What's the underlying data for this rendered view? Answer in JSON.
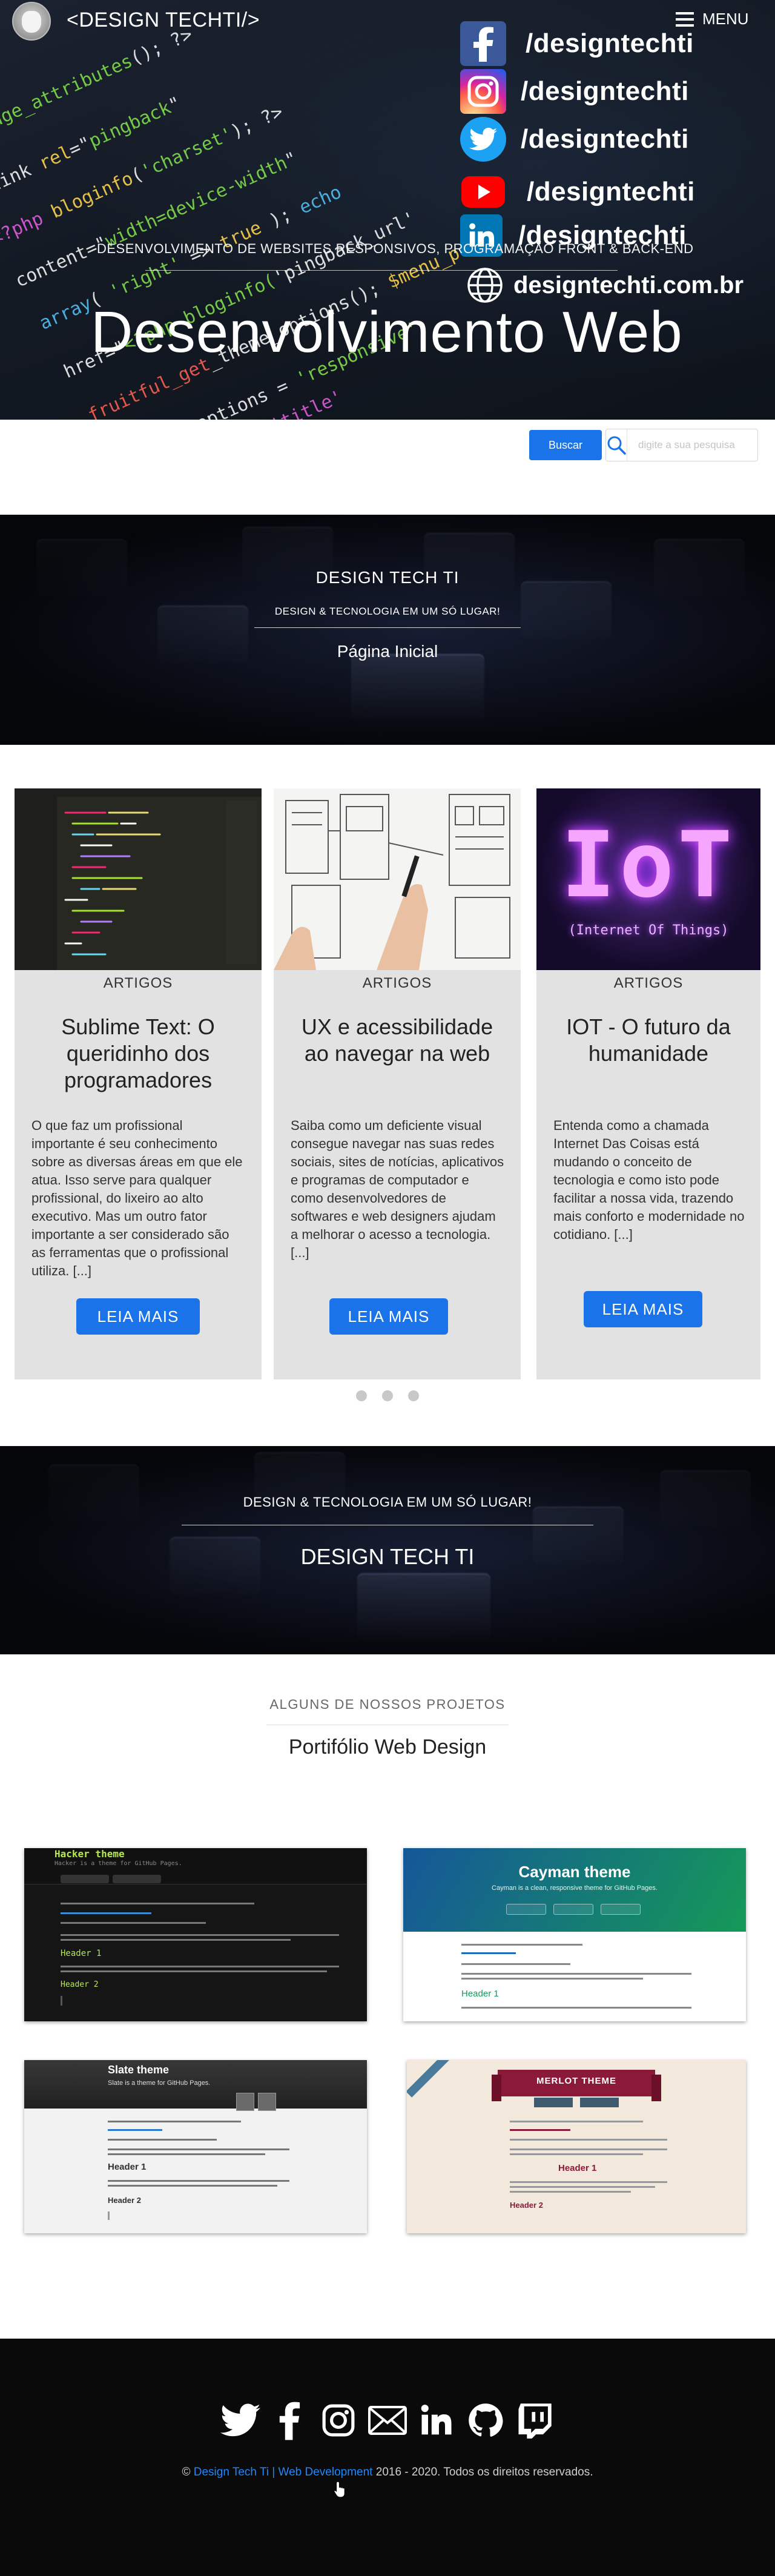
{
  "header": {
    "site_title": "<DESIGN TECHTI/>",
    "menu_label": "MENU"
  },
  "social_overlay": [
    {
      "network": "facebook",
      "icon": "facebook-icon",
      "color": "#3b5998",
      "handle": "/designtechti"
    },
    {
      "network": "instagram",
      "icon": "instagram-icon",
      "color": "#d6249f",
      "handle": "/designtechti"
    },
    {
      "network": "twitter",
      "icon": "twitter-icon",
      "color": "#1da1f2",
      "handle": "/designtechti"
    },
    {
      "network": "youtube",
      "icon": "youtube-icon",
      "color": "#ff0000",
      "handle": "/designtechti"
    },
    {
      "network": "linkedin",
      "icon": "linkedin-icon",
      "color": "#0077b5",
      "handle": "/designtechti"
    }
  ],
  "website": {
    "icon": "globe-icon",
    "label": "designtechti.com.br"
  },
  "hero": {
    "tagline": "DESENVOLVIMENTO DE WEBSITES RESPONSIVOS, PROGRAMAÇÃO FRONT & BACK-END",
    "heading": "Desenvolvimento Web"
  },
  "search": {
    "button_label": "Buscar",
    "placeholder": "digite a sua pesquisa"
  },
  "banner_top": {
    "title": "DESIGN TECH TI",
    "subtitle": "DESIGN & TECNOLOGIA EM UM SÓ LUGAR!",
    "link": "Página Inicial"
  },
  "articles": [
    {
      "category": "ARTIGOS",
      "title": "Sublime Text: O queridinho dos programadores",
      "excerpt": "O que faz um profissional importante é seu conhecimento sobre as diversas áreas em que ele atua. Isso serve para qualquer profissional, do lixeiro ao alto executivo. Mas um outro fator importante a ser considerado são as ferramentas que o profissional utiliza. [...]",
      "button": "LEIA MAIS"
    },
    {
      "category": "ARTIGOS",
      "title": "UX e acessibilidade ao navegar na web",
      "excerpt": "Saiba como um deficiente visual consegue navegar nas suas redes sociais, sites de notícias, aplicativos e programas de computador e como desenvolvedores de softwares e web designers ajudam a melhorar o acesso a tecnologia. [...]",
      "button": "LEIA MAIS"
    },
    {
      "category": "ARTIGOS",
      "title": "IOT - O futuro da humanidade",
      "excerpt": "Entenda como a chamada Internet Das Coisas está mudando o conceito de tecnologia e como isto pode facilitar a nossa vida, trazendo mais conforto e modernidade no cotidiano. [...]",
      "button": "LEIA MAIS",
      "image_text": "IoT",
      "image_caption": "(Internet Of Things)"
    }
  ],
  "carousel_dots": 3,
  "banner_mid": {
    "subtitle": "DESIGN & TECNOLOGIA EM UM SÓ LUGAR!",
    "title": "DESIGN TECH TI"
  },
  "portfolio": {
    "eyebrow": "ALGUNS DE NOSSOS PROJETOS",
    "title": "Portifólio Web Design",
    "projects": [
      {
        "name": "Hacker theme",
        "subtitle": "Hacker is a theme for GitHub Pages.",
        "header1": "Header 1",
        "header2": "Header 2"
      },
      {
        "name": "Cayman theme",
        "subtitle": "Cayman is a clean, responsive theme for GitHub Pages.",
        "header1": "Header 1"
      },
      {
        "name": "Slate theme",
        "subtitle": "Slate is a theme for GitHub Pages.",
        "header1": "Header 1",
        "header2": "Header 2"
      },
      {
        "name": "MERLOT THEME",
        "header1": "Header 1",
        "header2": "Header 2"
      }
    ]
  },
  "footer": {
    "icons": [
      "twitter-icon",
      "facebook-icon",
      "instagram-icon",
      "email-icon",
      "linkedin-icon",
      "github-icon",
      "twitch-icon"
    ],
    "copyright_prefix": "©",
    "link_text": "Design Tech Ti | Web Development",
    "copyright_suffix": "2016 - 2020. Todos os direitos reservados."
  },
  "colors": {
    "accent": "#1a73e8",
    "card_bg": "#e2e2e2",
    "footer_bg": "#0a0a0a"
  }
}
